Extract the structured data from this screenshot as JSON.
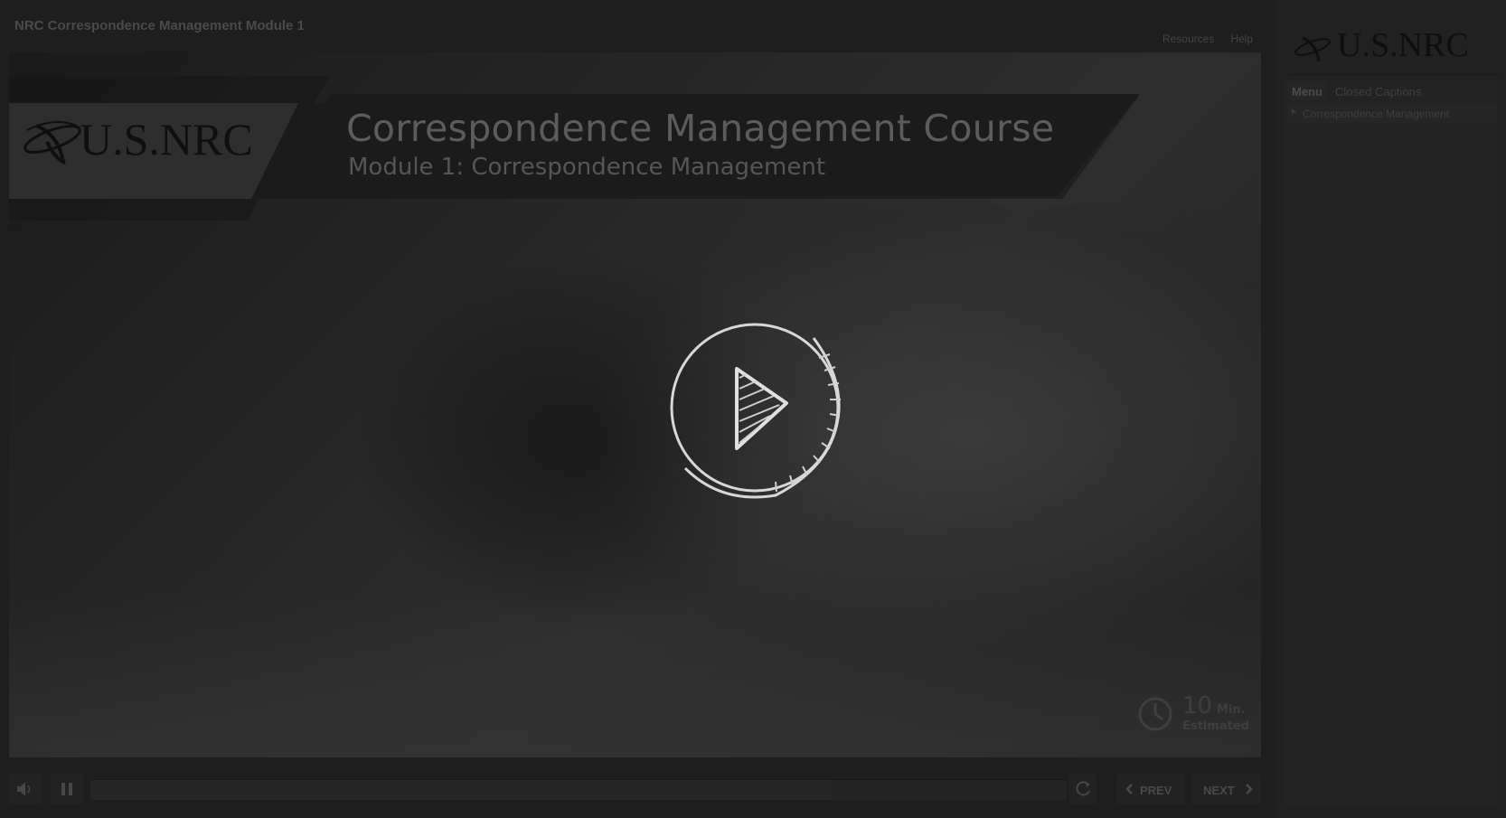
{
  "window": {
    "course_title": "NRC Correspondence Management Module 1"
  },
  "top_links": {
    "resources": "Resources",
    "help": "Help"
  },
  "slide": {
    "logo_text": "U.S.NRC",
    "title": "Correspondence Management Course",
    "subtitle": "Module 1:  Correspondence Management",
    "duration": {
      "value": "10",
      "unit": "Min.",
      "label": "Estimated"
    }
  },
  "player": {
    "prev_label": "PREV",
    "next_label": "NEXT",
    "progress": 0.76
  },
  "sidebar": {
    "logo_text": "U.S.NRC",
    "tabs": {
      "menu": "Menu",
      "captions": "Closed Captions"
    },
    "menu_items": [
      {
        "label": "Correspondence Management"
      }
    ]
  }
}
